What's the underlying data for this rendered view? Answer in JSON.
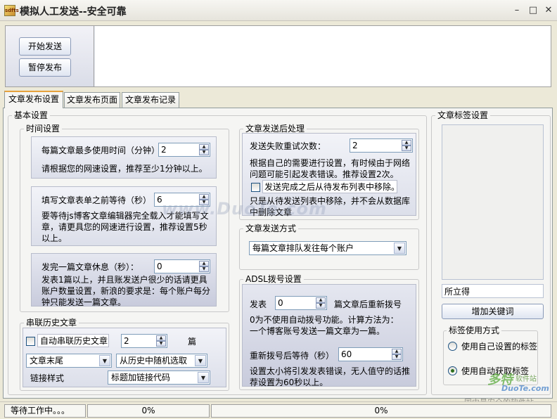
{
  "window": {
    "app_icon_text": "sdfts",
    "title": "模拟人工发送--安全可靠",
    "minimize_glyph": "–",
    "maximize_glyph": "□",
    "close_glyph": "✕"
  },
  "toolbar": {
    "start_label": "开始发送",
    "pause_label": "暂停发布"
  },
  "tabs": [
    {
      "label": "文章发布设置",
      "active": true
    },
    {
      "label": "文章发布页面",
      "active": false
    },
    {
      "label": "文章发布记录",
      "active": false
    }
  ],
  "basic_settings": {
    "title": "基本设置",
    "time_settings": {
      "title": "时间设置",
      "max_time_label": "每篇文章最多使用时间（分钟）",
      "max_time_value": "2",
      "max_time_hint": "请根据您的网速设置，推荐至少1分钟以上。",
      "wait_label": "填写文章表单之前等待（秒）",
      "wait_value": "6",
      "wait_hint": "要等待js博客文章编辑器完全载入才能填写文章，请更具您的网速进行设置，推荐设置5秒以上。",
      "rest_label": "发完一篇文章休息（秒）：",
      "rest_value": "0",
      "rest_hint": "发表1篇以上，并且账发送户很少的话请更具账户数量设置，新浪的要求是：每个账户每分钟只能发送一篇文章。"
    },
    "history": {
      "title": "串联历史文章",
      "auto_label": "自动串联历史文章",
      "count_value": "2",
      "count_unit": "篇",
      "position_value": "文章末尾",
      "source_value": "从历史中随机选取",
      "link_style_label": "链接样式",
      "link_style_value": "标题加链接代码"
    }
  },
  "post_processing": {
    "title": "文章发送后处理",
    "retry_label": "发送失败重试次数：",
    "retry_value": "2",
    "retry_hint": "根据自己的需要进行设置，有时候由于网络问题可能引起发表错误。推荐设置2次。",
    "remove_label": "发送完成之后从待发布列表中移除。",
    "remove_hint": "只是从待发送列表中移除，并不会从数据库中删除文章"
  },
  "send_method": {
    "title": "文章发送方式",
    "value": "每篇文章排队发往每个账户"
  },
  "adsl": {
    "title": "ADSL拨号设置",
    "redial_prefix": "发表",
    "redial_value": "0",
    "redial_suffix": "篇文章后重新拨号",
    "redial_hint": "0为不使用自动拨号功能。计算方法为：一个博客账号发送一篇文章为一篇。",
    "wait_label": "重新拨号后等待（秒）",
    "wait_value": "60",
    "wait_hint": "设置太小将引发发表错误，无人值守的话推荐设置为60秒以上。"
  },
  "tag_settings": {
    "title": "文章标签设置",
    "input_value": "所立得",
    "add_keyword_label": "增加关键词",
    "mode_title": "标签使用方式",
    "option_custom": "使用自己设置的标签",
    "option_auto": "使用自动获取标签",
    "selected_option": "auto"
  },
  "watermark": {
    "text": "www.DuoTe.com",
    "logo_cn": "多特",
    "logo_en": "DuoTe.com",
    "logo_sub": "软件站",
    "slogan": "国内最安全的软件站"
  },
  "status": {
    "state": "等待工作中。。。",
    "progress1": "0%",
    "progress2": "0%"
  }
}
